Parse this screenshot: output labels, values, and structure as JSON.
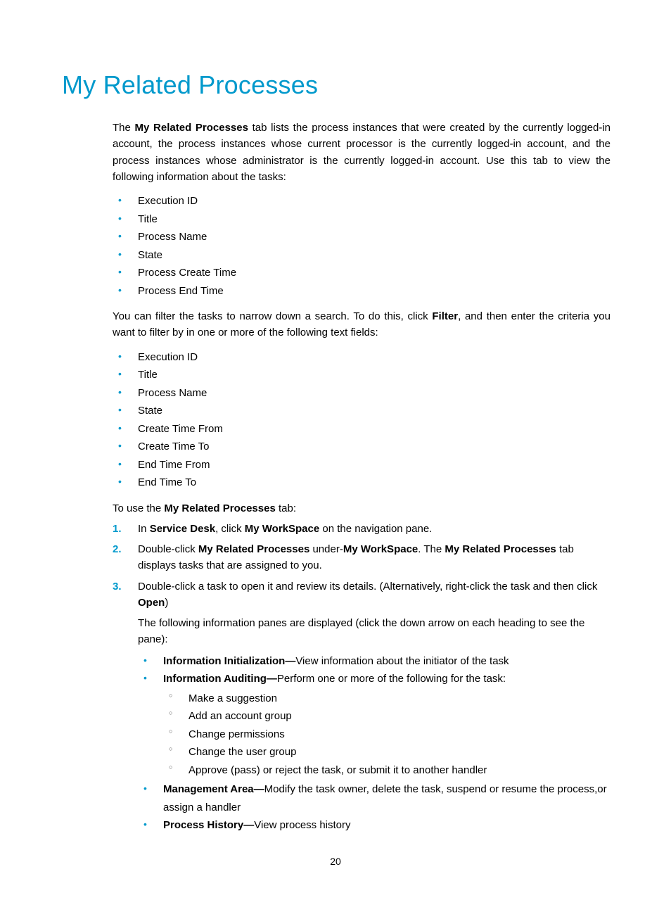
{
  "title": "My Related Processes",
  "intro": {
    "prefix": "The ",
    "bold": "My Related Processes",
    "suffix": " tab lists the process instances that were created by the currently logged-in account, the process instances whose current processor is the currently logged-in account, and the process instances whose administrator is the currently logged-in account. Use this tab to view the following information about the tasks:"
  },
  "info_items": [
    "Execution ID",
    "Title",
    "Process Name",
    "State",
    "Process Create Time",
    "Process End Time"
  ],
  "filter_para": {
    "pre": "You can filter the tasks to narrow down a search. To do this, click ",
    "bold": "Filter",
    "post": ", and then enter the criteria you want to filter by in one or more of the following text fields:"
  },
  "filter_items": [
    "Execution ID",
    "Title",
    "Process Name",
    "State",
    "Create Time From",
    "Create Time To",
    "End Time From",
    "End Time To"
  ],
  "use_para": {
    "pre": "To use the ",
    "bold": "My Related Processes",
    "post": " tab:"
  },
  "steps": {
    "s1": {
      "t1": "In ",
      "b1": "Service Desk",
      "t2": ", click ",
      "b2": "My WorkSpace",
      "t3": " on the navigation pane."
    },
    "s2": {
      "t1": "Double-click ",
      "b1": "My Related Processes",
      "t2": " under-",
      "b2": "My WorkSpace",
      "t3": ". The ",
      "b3": "My Related Processes",
      "t4": " tab displays tasks that are assigned to you."
    },
    "s3": {
      "line1_pre": "Double-click a task to open it and review its details. (Alternatively, right-click the task and then click ",
      "line1_bold": "Open",
      "line1_post": ")",
      "line2": "The following information panes are displayed (click the down arrow on each heading to see the pane):",
      "panes": {
        "p1": {
          "b": "Information Initialization—",
          "t": "View information about the initiator of the task"
        },
        "p2": {
          "b": "Information Auditing—",
          "t": "Perform one or more of the following  for the task:"
        },
        "audit": [
          "Make a suggestion",
          "Add an account group",
          "Change permissions",
          "Change the user group",
          "Approve (pass) or reject the task, or submit it to another handler"
        ],
        "p3": {
          "b": "Management Area—",
          "t": "Modify the task owner, delete the task, suspend or resume the process,or assign a handler"
        },
        "p4": {
          "b": "Process History—",
          "t": "View process history"
        }
      }
    }
  },
  "page_number": "20"
}
